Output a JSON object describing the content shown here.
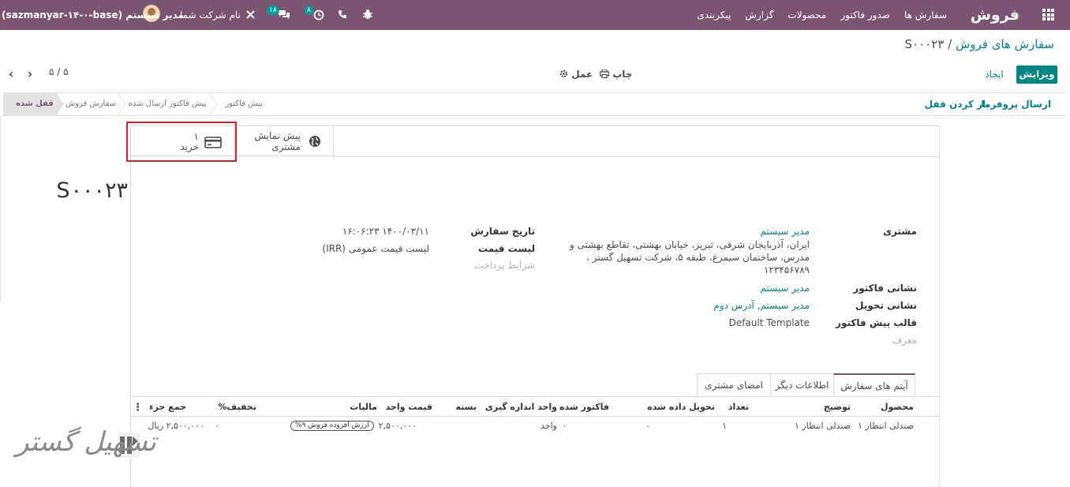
{
  "navbar": {
    "brand": "فروش",
    "menu": [
      "سفارش ها",
      "صدور فاکتور",
      "محصولات",
      "گزارش",
      "پیکربندی"
    ],
    "company": "نام شرکت شما",
    "user": "مدیر سیستم (sazmanyar-۱۴-۰-base)",
    "messages_count": "۱۸",
    "activities_count": "۸"
  },
  "breadcrumb": {
    "parent": "سفارش های فروش",
    "separator": "/",
    "current": "S۰۰۰۲۳"
  },
  "buttons": {
    "edit": "ویرایش",
    "create": "ایجاد",
    "print": "چاپ",
    "action": "عمل"
  },
  "pager": {
    "value": "۵ / ۵"
  },
  "header_buttons": {
    "send_proforma": "ارسال پروفرما",
    "unlock": "باز کردن قفل"
  },
  "stages": [
    "قفل شده",
    "سفارش فروش",
    "پیش فاکتور ارسال شده",
    "پیش فاکتور"
  ],
  "smart_buttons": {
    "preview_line1": "پیش نمایش",
    "preview_line2": "مشتری",
    "invoice_count": "۱",
    "invoice_label": "خرید"
  },
  "title": "S۰۰۰۲۳",
  "fields": {
    "customer_label": "مشتری",
    "customer_name": "مدیر سیستم",
    "customer_addr_1": "ایران، آذربایجان شرقی، تبریز، خیابان بهشتی، تقاطع بهشتی و",
    "customer_addr_2": "مدرس، ساختمان سیمرغ، طبقه ۵، شرکت تسهیل گستر ،",
    "customer_addr_3": "۱۲۳۴۵۶۷۸۹",
    "invoice_address_label": "نشانی فاکتور",
    "invoice_address": "مدیر سیستم",
    "delivery_address_label": "نشانی تحویل",
    "delivery_address": "مدیر سیستم, آدرس دوم",
    "template_label": "قالب پیش فاکتور",
    "template": "Default Template",
    "referrer_placeholder": "معرف",
    "order_date_label": "تاریخ سفارش",
    "order_date": "۱۴۰۰/۰۳/۱۱ ۱۶:۰۶:۲۳",
    "pricelist_label": "لیست قیمت",
    "pricelist": "لیست قیمت عمومی (IRR)",
    "payment_terms_placeholder": "شرایط پرداخت"
  },
  "tabs": [
    "آیتم های سفارش",
    "اطلاعات دیگر",
    "امضای مشتری"
  ],
  "table": {
    "headers": [
      "محصول",
      "توضیح",
      "تعداد",
      "تحویل داده شده",
      "فاکتور شده",
      "واحد اندازه گیری",
      "بسته",
      "قیمت واحد",
      "مالیات",
      "تخفیف%",
      "جمع جزء"
    ],
    "row": {
      "product": "صندلی انتظار ۱",
      "description": "صندلی انتظار ۱",
      "quantity": "۱",
      "delivered": "۰",
      "invoiced": "۰",
      "uom": "واحد",
      "package": "",
      "unit_price": "۲,۵۰۰,۰۰۰",
      "tax": "ارزش افزوده فروش ۹%",
      "discount": "۰",
      "subtotal": "۲,۵۰۰,۰۰۰ ریال"
    }
  },
  "watermark": "تسهیل گستر"
}
